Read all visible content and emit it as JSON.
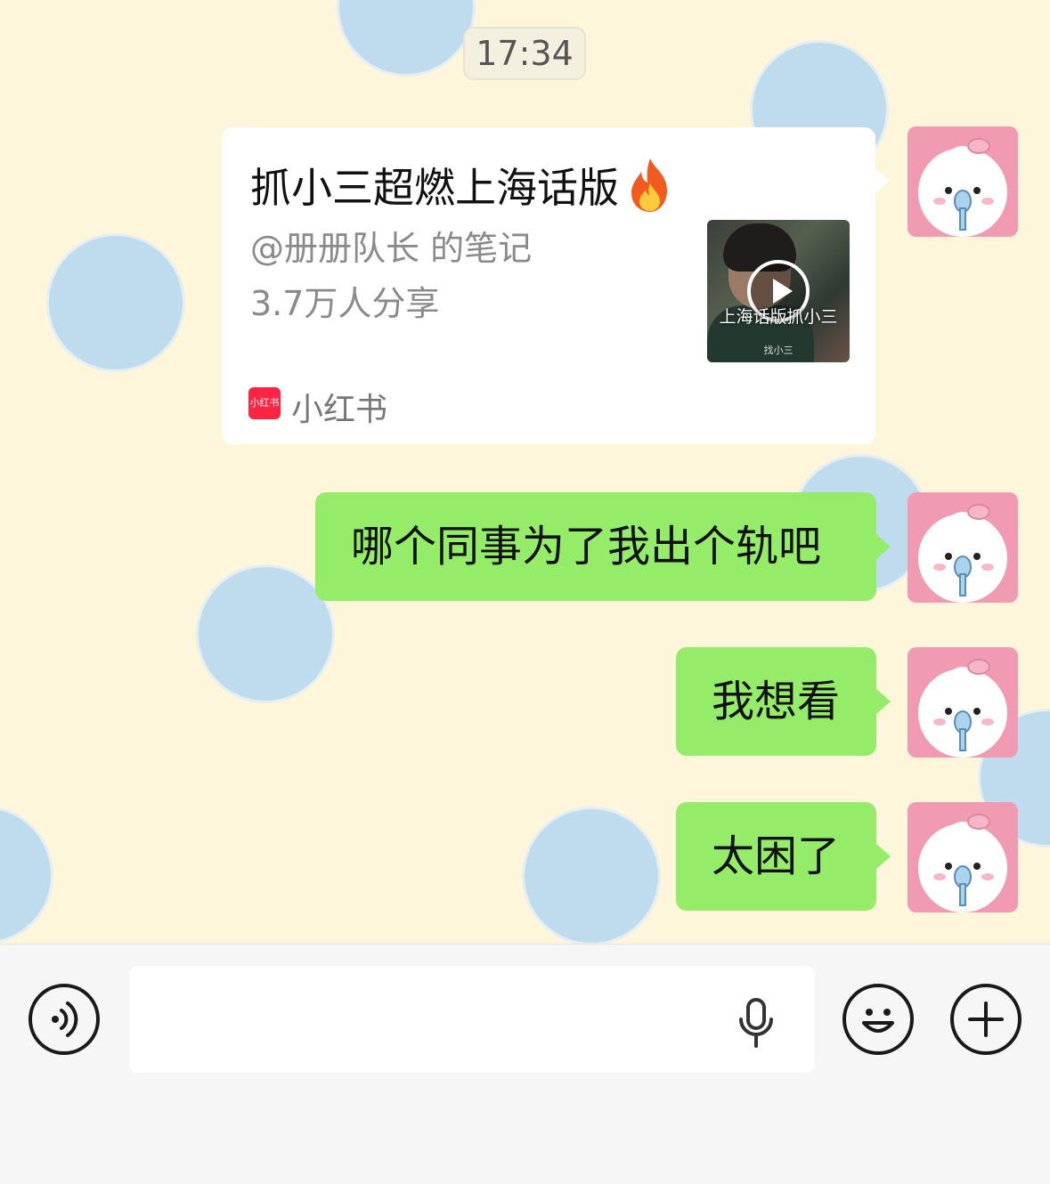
{
  "timestamp": "17:34",
  "share_card": {
    "title": "抓小三超燃上海话版",
    "author": "@册册队长 的笔记",
    "shares": "3.7万人分享",
    "thumbnail_caption": "上海话版抓小三",
    "thumbnail_subcaption": "找小三",
    "source_logo_text": "小红书",
    "source_name": "小红书",
    "emoji": "fire"
  },
  "messages": [
    {
      "text": "哪个同事为了我出个轨吧"
    },
    {
      "text": "我想看"
    },
    {
      "text": "太困了"
    }
  ],
  "colors": {
    "chat_background": "#fdf6da",
    "polka_dot": "#bfdcef",
    "sent_bubble": "#95ec69",
    "card_background": "#ffffff",
    "avatar_background": "#f19bb3",
    "input_bar": "#f6f6f6"
  },
  "input_bar": {
    "voice_button_icon": "voice-icon",
    "mic_icon": "microphone-icon",
    "emoji_button_icon": "smiley-icon",
    "more_button_icon": "plus-icon"
  }
}
